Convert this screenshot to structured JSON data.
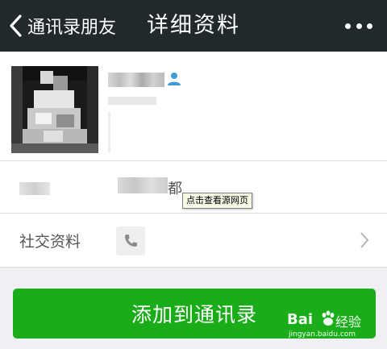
{
  "header": {
    "back_label": "通讯录朋友",
    "title": "详细资料",
    "more_icon": "more-dots-icon",
    "background": "#22292c"
  },
  "profile": {
    "avatar": "pixelated-avatar",
    "contact_badge_icon": "contact-person-icon",
    "contact_badge_color": "#3f9ad6"
  },
  "region_row": {
    "value_visible_char": "都",
    "tooltip": "点击查看源网页"
  },
  "social_row": {
    "label": "社交资料",
    "phone_icon": "phone-icon",
    "chevron_icon": "chevron-right-icon"
  },
  "add_button": {
    "label": "添加到通讯录",
    "color": "#1aad19"
  },
  "watermark": {
    "brand_latin": "Bai",
    "brand_cn": "经验",
    "url": "jingyan.baidu.com"
  }
}
